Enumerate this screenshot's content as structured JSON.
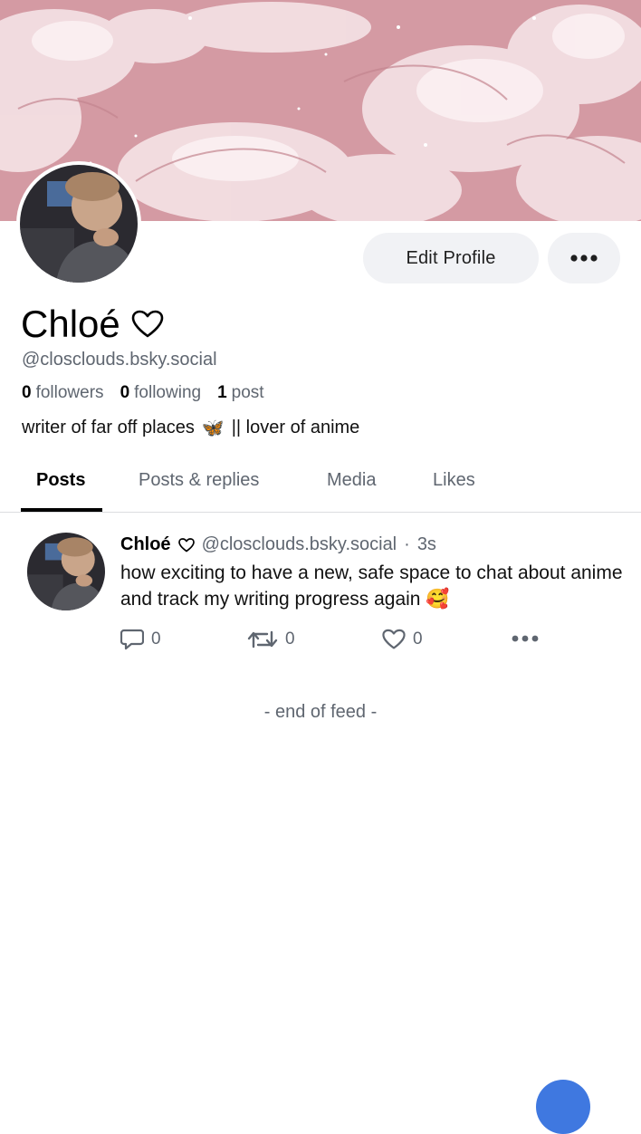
{
  "profile": {
    "display_name": "Chloé",
    "handle": "@closclouds.bsky.social",
    "followers_count": "0",
    "followers_label": "followers",
    "following_count": "0",
    "following_label": "following",
    "posts_count": "1",
    "posts_label": "post",
    "bio_before": "writer of far off places",
    "bio_emoji": "🦋",
    "bio_after": "|| lover of anime"
  },
  "buttons": {
    "edit_profile": "Edit Profile"
  },
  "tabs": [
    {
      "label": "Posts",
      "active": true
    },
    {
      "label": "Posts & replies",
      "active": false
    },
    {
      "label": "Media",
      "active": false
    },
    {
      "label": "Likes",
      "active": false
    }
  ],
  "feed": {
    "posts": [
      {
        "author_name": "Chloé",
        "author_handle": "@closclouds.bsky.social",
        "separator": "·",
        "time": "3s",
        "text": "how exciting to have a new, safe space to chat about anime and track my writing progress again 🥰",
        "replies": "0",
        "reposts": "0",
        "likes": "0"
      }
    ],
    "end_text": "- end of feed -"
  },
  "icons": {
    "heart": "heart-outline-icon",
    "more": "more-horizontal-icon",
    "reply": "speech-bubble-icon",
    "repost": "repost-icon",
    "like": "heart-icon",
    "compose": "compose-fab"
  },
  "colors": {
    "banner_pink": "#d49aa3",
    "muted_text": "#5f6670",
    "button_bg": "#f1f2f5",
    "accent_blue": "#3f78e0"
  }
}
